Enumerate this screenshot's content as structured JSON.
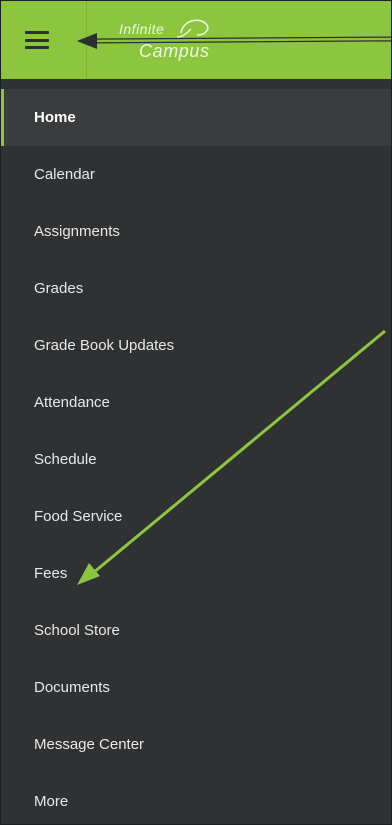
{
  "brand": {
    "line1": "Infinite",
    "line2": "Campus",
    "header_color": "#8cc63f"
  },
  "menu": {
    "icon": "hamburger-icon"
  },
  "nav": {
    "items": [
      {
        "label": "Home",
        "active": true
      },
      {
        "label": "Calendar"
      },
      {
        "label": "Assignments"
      },
      {
        "label": "Grades"
      },
      {
        "label": "Grade Book Updates"
      },
      {
        "label": "Attendance"
      },
      {
        "label": "Schedule"
      },
      {
        "label": "Food Service"
      },
      {
        "label": "Fees"
      },
      {
        "label": "School Store"
      },
      {
        "label": "Documents"
      },
      {
        "label": "Message Center"
      },
      {
        "label": "More"
      }
    ]
  },
  "annotations": {
    "arrow_color": "#8cc63f"
  }
}
